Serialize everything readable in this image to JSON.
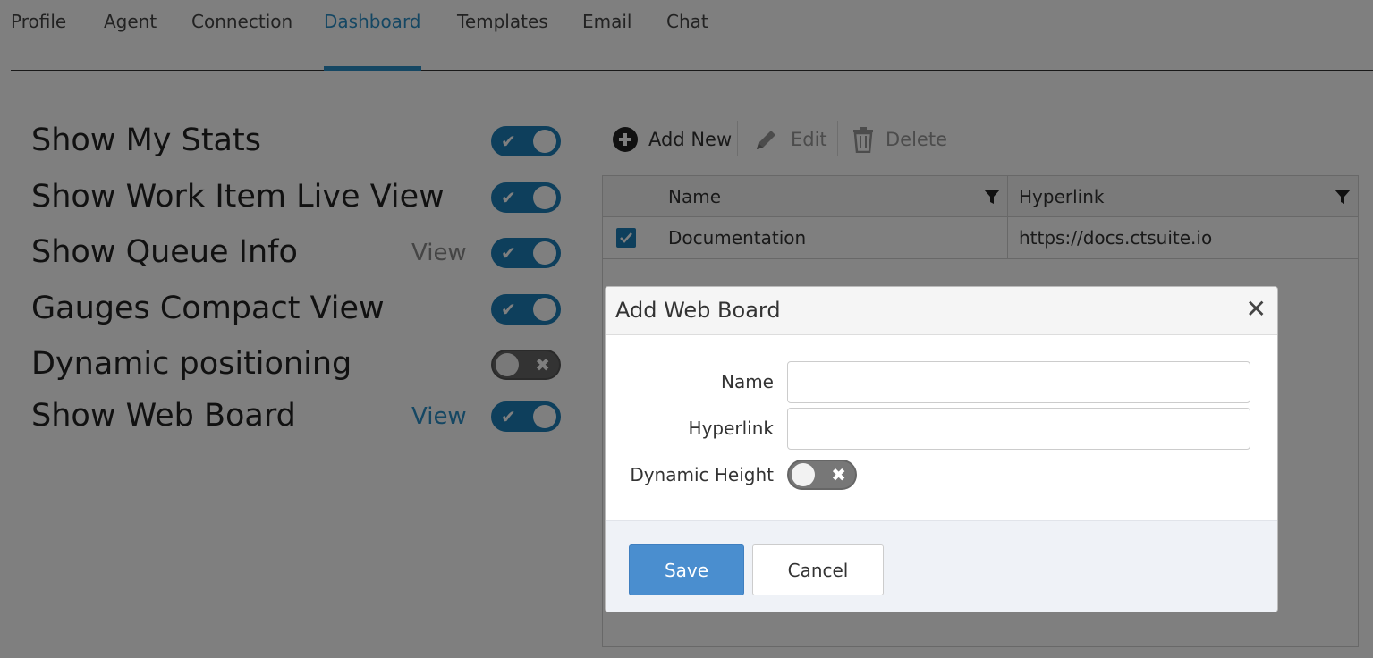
{
  "tabs": [
    {
      "label": "Profile"
    },
    {
      "label": "Agent"
    },
    {
      "label": "Connection"
    },
    {
      "label": "Dashboard",
      "active": true
    },
    {
      "label": "Templates"
    },
    {
      "label": "Email"
    },
    {
      "label": "Chat"
    }
  ],
  "settings": [
    {
      "label": "Show My Stats",
      "enabled": true
    },
    {
      "label": "Show Work Item Live View",
      "enabled": true
    },
    {
      "label": "Show Queue Info",
      "view_link": "View",
      "enabled": true
    },
    {
      "label": "Gauges Compact View",
      "enabled": true
    },
    {
      "label": "Dynamic positioning",
      "enabled": false
    },
    {
      "label": "Show Web Board",
      "view_link": "View",
      "enabled": true
    }
  ],
  "toolbar": {
    "add_label": "Add New",
    "edit_label": "Edit",
    "delete_label": "Delete"
  },
  "grid": {
    "columns": [
      "Name",
      "Hyperlink"
    ],
    "rows": [
      {
        "selected": true,
        "name": "Documentation",
        "hyperlink": "https://docs.ctsuite.io"
      }
    ]
  },
  "dialog": {
    "title": "Add Web Board",
    "close_glyph": "✕",
    "name_label": "Name",
    "name_value": "",
    "hyperlink_label": "Hyperlink",
    "hyperlink_value": "",
    "dynamic_height_label": "Dynamic Height",
    "dynamic_height_enabled": false,
    "save_label": "Save",
    "cancel_label": "Cancel"
  },
  "colors": {
    "accent": "#2a8ec7",
    "toggle_on": "#1c7fb8",
    "toggle_off": "#666666",
    "primary_button": "#4a8ecf",
    "view_link_active": "#2a8ec7",
    "view_link_muted": "#8a8a8a"
  }
}
